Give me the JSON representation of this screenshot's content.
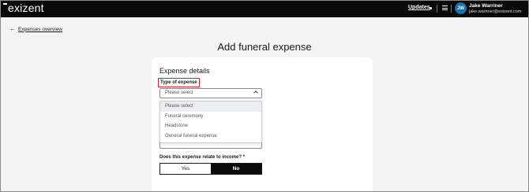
{
  "header": {
    "logo": "exizent",
    "updates_label": "Updates",
    "user": {
      "initials": "JW",
      "name": "Jake Warriner",
      "email": "jake.warriner@exizent.com"
    },
    "avatar_color": "#1e6fa8"
  },
  "nav": {
    "back_label": "Expenses overview"
  },
  "page": {
    "title": "Add funeral expense"
  },
  "form": {
    "section_title": "Expense details",
    "type_of_expense": {
      "label": "Type of expense",
      "placeholder": "Please select",
      "options": [
        "Please select",
        "Funeral ceremony",
        "Headstone",
        "General funeral expense"
      ],
      "selected_index": 0
    },
    "income_question": {
      "label": "Does this expense relate to income? *",
      "yes_label": "Yes",
      "no_label": "No",
      "selected": "No"
    }
  },
  "colors": {
    "header_bg": "#0a0a0a",
    "highlight_border": "#d32020",
    "selected_option_bg": "#e9eef3"
  }
}
